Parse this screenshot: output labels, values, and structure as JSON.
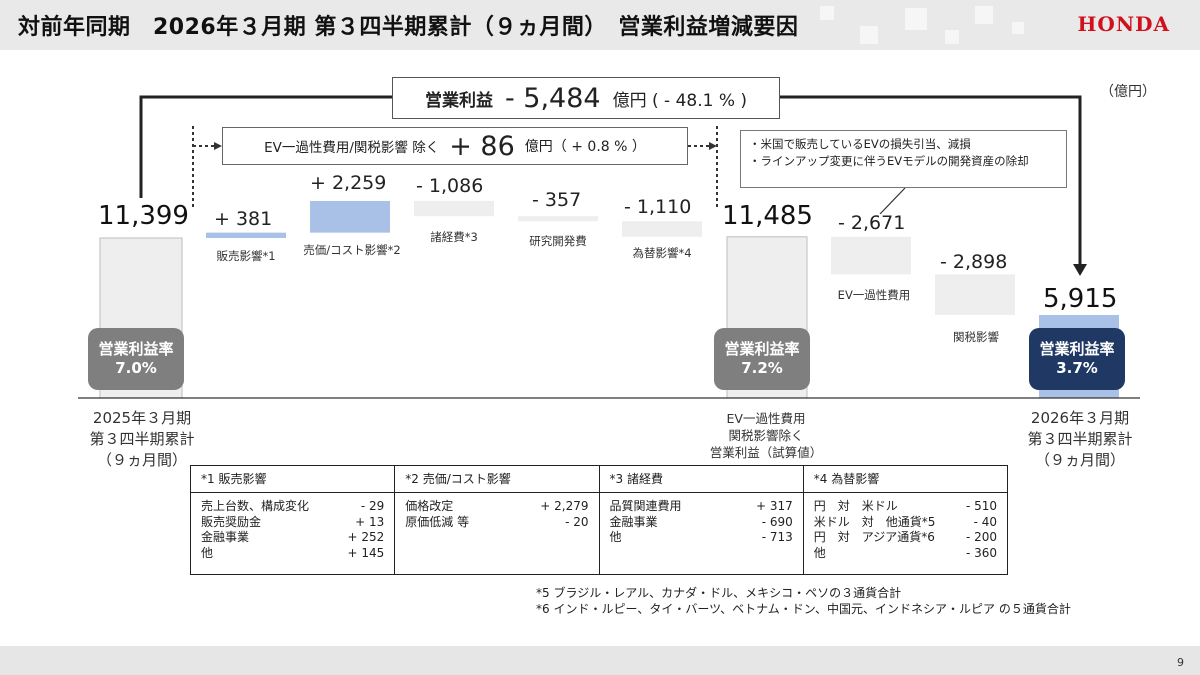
{
  "header": {
    "title": "対前年同期　2026年３月期 第３四半期累計（９ヵ月間）　営業利益増減要因",
    "logo": "HONDA"
  },
  "unit_label": "（億円）",
  "op_change_box": {
    "label": "営業利益",
    "value": "- 5,484",
    "unit": "億円 ( - 48.1 % )"
  },
  "ev_excl_box": {
    "label": "EV一過性費用/関税影響 除く",
    "value": "+ 86",
    "unit": "億円（ + 0.8 % ）"
  },
  "note_box": {
    "lines": [
      "・米国で販売しているEVの損失引当、減損",
      "・ラインアップ変更に伴うEVモデルの開発資産の除却"
    ]
  },
  "chart_data": {
    "type": "bar",
    "subtype": "waterfall",
    "categories": [
      "2025年３月期 第３四半期累計（９ヵ月間）",
      "販売影響*1",
      "売価/コスト影響*2",
      "諸経費*3",
      "研究開発費",
      "為替影響*4",
      "EV一過性費用 関税影響除く 営業利益（試算値）",
      "EV一過性費用",
      "関税影響",
      "2026年３月期 第３四半期累計（９ヵ月間）"
    ],
    "values": [
      11399,
      381,
      2259,
      -1086,
      -357,
      -1110,
      11485,
      -2671,
      -2898,
      5915
    ],
    "value_labels": [
      "11,399",
      "+ 381",
      "+ 2,259",
      "- 1,086",
      "- 357",
      "- 1,110",
      "11,485",
      "- 2,671",
      "- 2,898",
      "5,915"
    ],
    "kinds": [
      "total",
      "delta",
      "delta",
      "delta",
      "delta",
      "delta",
      "total",
      "delta",
      "delta",
      "total"
    ],
    "ylabel": "億円",
    "operating_margins": [
      "7.0%",
      "7.2%",
      "3.7%"
    ],
    "margin_label": "営業利益率",
    "colors": {
      "total": "#eeeeee",
      "positive": "#a9c1e6",
      "negative": "#eeeeee",
      "final": "#a9c1e6",
      "badge_grey": "#7f7f7f",
      "badge_navy": "#1f3864"
    }
  },
  "labels": {
    "start": [
      "2025年３月期",
      "第３四半期累計",
      "（９ヵ月間）"
    ],
    "mid": [
      "EV一過性費用",
      "関税影響除く",
      "営業利益（試算値）"
    ],
    "end": [
      "2026年３月期",
      "第３四半期累計",
      "（９ヵ月間）"
    ],
    "cat_sales": "販売影響*1",
    "cat_price": "売価/コスト影響*2",
    "cat_sga": "諸経費*3",
    "cat_rd": "研究開発費",
    "cat_fx": "為替影響*4",
    "cat_ev": "EV一過性費用",
    "cat_tariff": "関税影響"
  },
  "detail_table": [
    {
      "head": "*1 販売影響",
      "rows": [
        [
          "売上台数、構成変化",
          "- 29"
        ],
        [
          "販売奨励金",
          "+ 13"
        ],
        [
          "金融事業",
          "+ 252"
        ],
        [
          "他",
          "+ 145"
        ]
      ]
    },
    {
      "head": "*2 売価/コスト影響",
      "rows": [
        [
          "価格改定",
          "+ 2,279"
        ],
        [
          "原価低減 等",
          "- 20"
        ]
      ]
    },
    {
      "head": "*3 諸経費",
      "rows": [
        [
          "品質関連費用",
          "+ 317"
        ],
        [
          "金融事業",
          "- 690"
        ],
        [
          "他",
          "- 713"
        ]
      ]
    },
    {
      "head": "*4 為替影響",
      "rows": [
        [
          "円　対　米ドル",
          "- 510"
        ],
        [
          "米ドル　対　他通貨*5",
          "- 40"
        ],
        [
          "円　対　アジア通貨*6",
          "- 200"
        ],
        [
          "他",
          "- 360"
        ]
      ]
    }
  ],
  "footnotes": [
    "*5 ブラジル・レアル、カナダ・ドル、メキシコ・ペソの３通貨合計",
    "*6 インド・ルピー、タイ・バーツ、ベトナム・ドン、中国元、インドネシア・ルピア の５通貨合計"
  ],
  "page_number": "9"
}
